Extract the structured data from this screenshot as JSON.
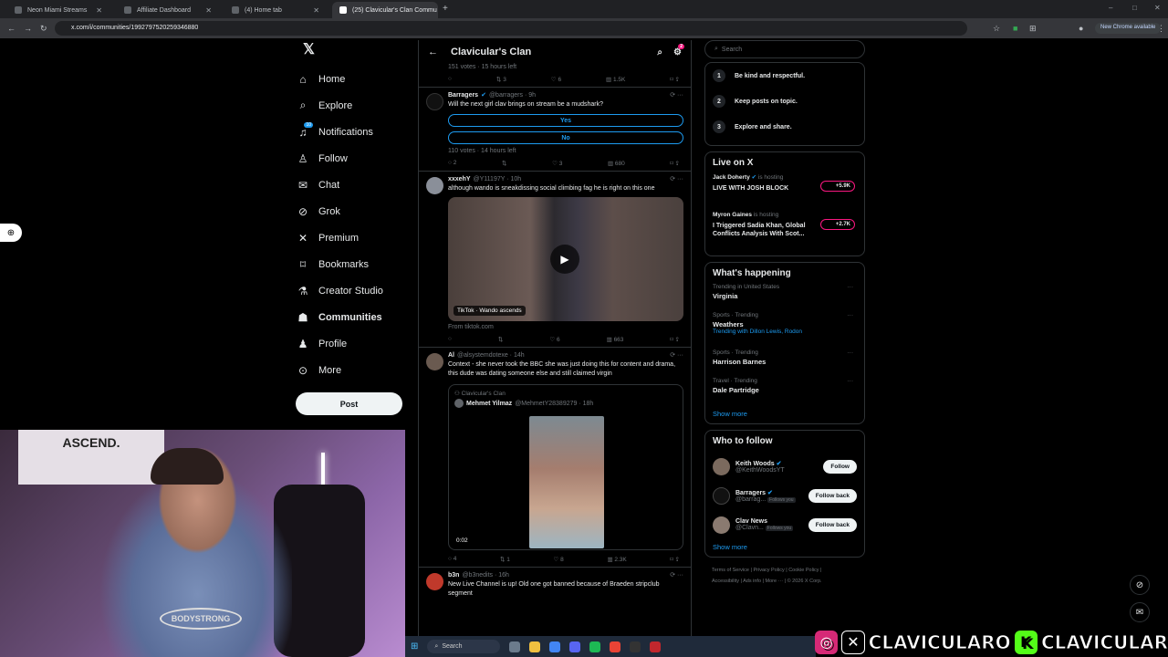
{
  "browser": {
    "tabs": [
      {
        "label": "Neon Miami Streams"
      },
      {
        "label": "Affiliate Dashboard"
      },
      {
        "label": "(4) Home tab"
      },
      {
        "label": "(25) Clavicular's Clan Commu"
      }
    ],
    "url": "x.com/i/communities/1992797520259346880",
    "new_chrome": "New Chrome available"
  },
  "nav": {
    "items": [
      {
        "label": "Home",
        "icon": "home-icon"
      },
      {
        "label": "Explore",
        "icon": "search-icon"
      },
      {
        "label": "Notifications",
        "icon": "bell-icon",
        "badge": "10"
      },
      {
        "label": "Follow",
        "icon": "person-plus-icon"
      },
      {
        "label": "Chat",
        "icon": "mail-icon"
      },
      {
        "label": "Grok",
        "icon": "grok-icon"
      },
      {
        "label": "Premium",
        "icon": "x-icon"
      },
      {
        "label": "Bookmarks",
        "icon": "bookmark-icon"
      },
      {
        "label": "Creator Studio",
        "icon": "flask-icon"
      },
      {
        "label": "Communities",
        "icon": "people-icon"
      },
      {
        "label": "Profile",
        "icon": "person-icon"
      },
      {
        "label": "More",
        "icon": "more-circle-icon"
      }
    ],
    "post_label": "Post"
  },
  "webcam": {
    "banner": "ASCEND.",
    "shirt": "BODYSTRONG"
  },
  "feed": {
    "title": "Clavicular's Clan",
    "settings_badge": "2",
    "poll_top": {
      "meta": "151 votes · 15 hours left",
      "replies": "",
      "reposts": "3",
      "likes": "6",
      "views": "1.5K"
    },
    "t1": {
      "name": "Barragers",
      "handle": "@barragers · 9h",
      "text": "Will the next girl clav brings on stream be a mudshark?",
      "opt1": "Yes",
      "opt2": "No",
      "meta": "110 votes · 14 hours left",
      "replies": "2",
      "reposts": "",
      "likes": "3",
      "views": "680"
    },
    "t2": {
      "name": "xxxehY",
      "handle": "@Y11197Y · 10h",
      "text": "although wando is sneakdissing social climbing fag he is right on this one",
      "media_label": "TikTok · Wando ascends",
      "from": "From tiktok.com",
      "replies": "",
      "reposts": "",
      "likes": "6",
      "views": "663"
    },
    "t3": {
      "name": "Al",
      "handle": "@alsystemdotexe · 14h",
      "text": "Context - she never took the BBC she was just doing this for content and drama, this dude was dating someone else and still claimed virgin",
      "quote_comm": "Clavicular's Clan",
      "quote_name": "Mehmet Yilmaz",
      "quote_handle": "@MehmetY28389279 · 18h",
      "quote_time": "0:02",
      "replies": "4",
      "reposts": "1",
      "likes": "8",
      "views": "2.3K"
    },
    "t4": {
      "name": "b3n",
      "handle": "@b3nedits · 16h",
      "text": "New Live Channel is up! Old one got banned because of Braeden stripclub segment"
    }
  },
  "right": {
    "search_placeholder": "Search",
    "rules": [
      {
        "n": "1",
        "text": "Be kind and respectful."
      },
      {
        "n": "2",
        "text": "Keep posts on topic."
      },
      {
        "n": "3",
        "text": "Explore and share."
      }
    ],
    "live_title": "Live on X",
    "live": [
      {
        "host": "Jack Doherty",
        "suffix": "is hosting",
        "title": "LIVE WITH JOSH BLOCK",
        "count": "+5.9K"
      },
      {
        "host": "Myron Gaines",
        "suffix": "is hosting",
        "title": "I Triggered Sadia Khan, Global Conflicts Analysis With Scot...",
        "count": "+2.7K"
      }
    ],
    "happening_title": "What's happening",
    "trends": [
      {
        "context": "Trending in United States",
        "name": "Virginia",
        "with": ""
      },
      {
        "context": "Sports · Trending",
        "name": "Weathers",
        "with": "Trending with Dillon Lewis, Rodon"
      },
      {
        "context": "Sports · Trending",
        "name": "Harrison Barnes",
        "with": ""
      },
      {
        "context": "Travel · Trending",
        "name": "Dale Partridge",
        "with": ""
      }
    ],
    "show_more": "Show more",
    "wtf_title": "Who to follow",
    "wtf": [
      {
        "name": "Keith Woods",
        "handle": "@KeithWoodsYT",
        "follows": "",
        "button": "Follow"
      },
      {
        "name": "Barragers",
        "handle": "@barrag...",
        "follows": "Follows you",
        "button": "Follow back"
      },
      {
        "name": "Clav News",
        "handle": "@Clavn...",
        "follows": "Follows you",
        "button": "Follow back"
      }
    ],
    "footer": [
      "Terms of Service",
      "Privacy Policy",
      "Cookie Policy",
      "Accessibility",
      "Ads info",
      "More ···",
      "© 2026 X Corp."
    ]
  },
  "taskbar": {
    "search": "Search"
  },
  "overlay": {
    "text1": "CLAVICULARO",
    "text2": "CLAVICULAR",
    "colors": {
      "ig": "#d62976",
      "kick": "#53fc18"
    }
  }
}
